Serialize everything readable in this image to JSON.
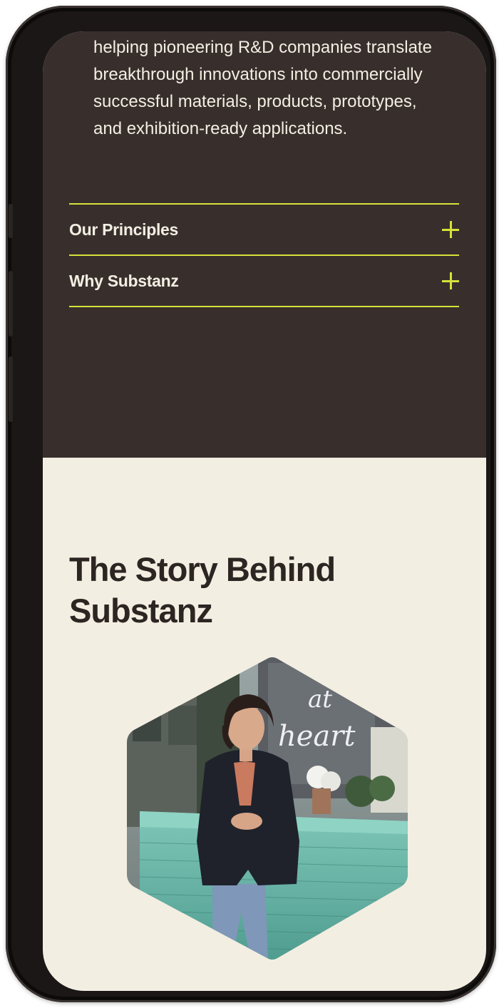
{
  "intro": {
    "text": "helping pioneering R&D companies translate breakthrough innovations into commercially successful materials, products, prototypes, and exhibition-ready applications."
  },
  "accordion": {
    "items": [
      {
        "label": "Our Principles",
        "icon": "plus-icon"
      },
      {
        "label": "Why Substanz",
        "icon": "plus-icon"
      }
    ]
  },
  "story": {
    "title": "The Story Behind Substanz"
  },
  "photo": {
    "shape": "hexagon",
    "neon_text_1": "at",
    "neon_text_2": "heart"
  },
  "colors": {
    "dark_bg": "#382f2d",
    "light_bg": "#f3eee2",
    "accent": "#d6e23a",
    "heading": "#2c2522"
  }
}
